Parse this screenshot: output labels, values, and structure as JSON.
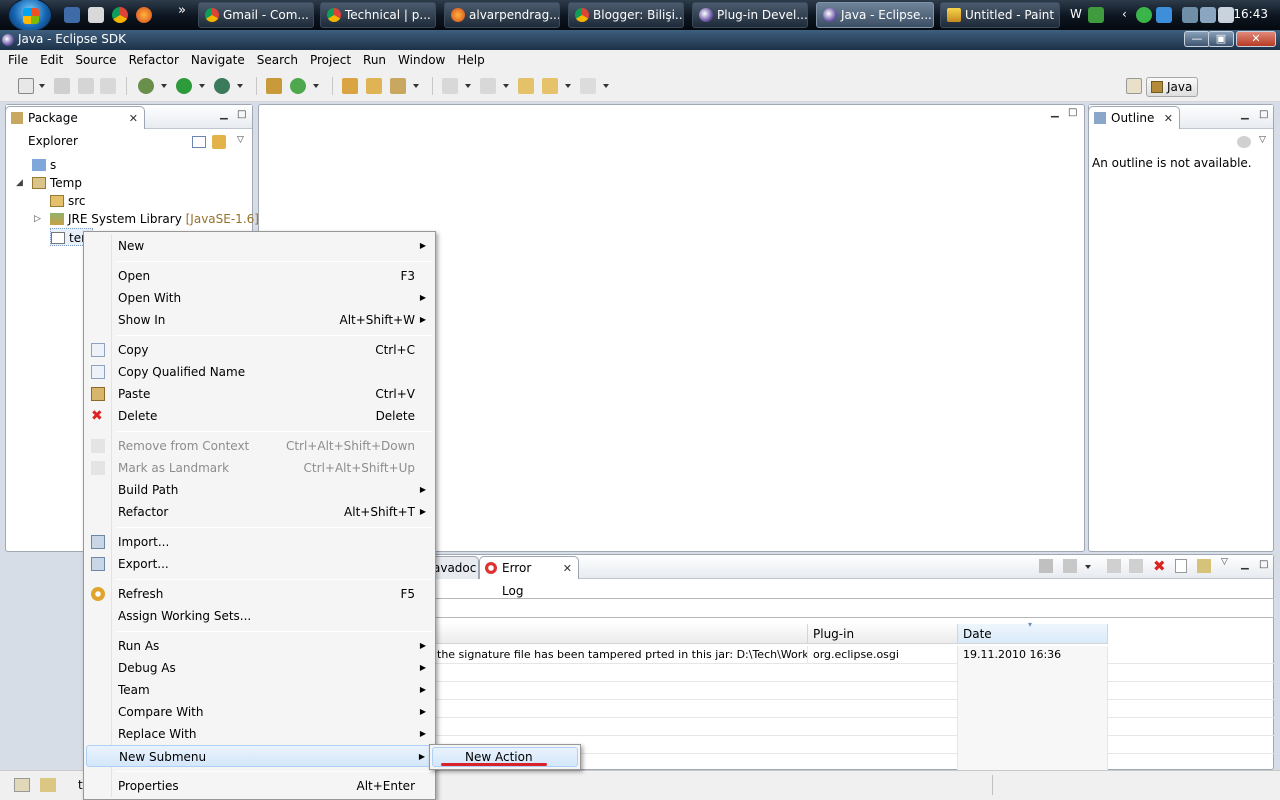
{
  "taskbar": {
    "buttons": [
      {
        "label": "Gmail - Com...",
        "icon": "chrome-icon"
      },
      {
        "label": "Technical | p...",
        "icon": "chrome-icon"
      },
      {
        "label": "alvarpendrag...",
        "icon": "firefox-icon"
      },
      {
        "label": "Blogger: Bilişi...",
        "icon": "chrome-icon"
      },
      {
        "label": "Plug-in Devel...",
        "icon": "eclipse-icon"
      },
      {
        "label": "Java - Eclipse...",
        "icon": "eclipse-icon",
        "active": true
      },
      {
        "label": "Untitled - Paint",
        "icon": "paint-icon"
      }
    ],
    "tray_letter": "W",
    "clock": "16:43"
  },
  "window": {
    "title": "Java - Eclipse SDK"
  },
  "menubar": [
    "File",
    "Edit",
    "Source",
    "Refactor",
    "Navigate",
    "Search",
    "Project",
    "Run",
    "Window",
    "Help"
  ],
  "perspective": {
    "label": "Java"
  },
  "package_explorer": {
    "tab": "Package Explorer",
    "tree": [
      {
        "label": "s",
        "depth": 0,
        "icon": "project-icon"
      },
      {
        "label": "Temp",
        "depth": 0,
        "icon": "project-open-icon",
        "expanded": true
      },
      {
        "label": "src",
        "depth": 1,
        "icon": "package-folder-icon"
      },
      {
        "label": "JRE System Library",
        "tag": "[JavaSE-1.6]",
        "depth": 1,
        "icon": "library-icon"
      },
      {
        "label": "ter",
        "depth": 1,
        "icon": "file-icon",
        "selected": true
      }
    ]
  },
  "outline": {
    "tab": "Outline",
    "message": "An outline is not available."
  },
  "bottom_panel": {
    "tabs": [
      "avadoc",
      "Error Log"
    ],
    "columns": [
      "Plug-in",
      "Date"
    ],
    "rows": [
      {
        "message": "the signature file has been tampered prted in this jar: D:\\Tech\\WorkSpaces\\H",
        "plugin": "org.eclipse.osgi",
        "date": "19.11.2010 16:36"
      }
    ]
  },
  "status": {
    "text": "t"
  },
  "context_menu": {
    "items": [
      {
        "label": "New",
        "submenu": true,
        "icon": ""
      },
      {
        "sep": true
      },
      {
        "label": "Open",
        "shortcut": "F3"
      },
      {
        "label": "Open With",
        "submenu": true
      },
      {
        "label": "Show In",
        "shortcut": "Alt+Shift+W",
        "submenu": true
      },
      {
        "sep": true
      },
      {
        "label": "Copy",
        "shortcut": "Ctrl+C",
        "icon": "copy-icon"
      },
      {
        "label": "Copy Qualified Name",
        "icon": "copy-qualified-icon"
      },
      {
        "label": "Paste",
        "shortcut": "Ctrl+V",
        "icon": "paste-icon"
      },
      {
        "label": "Delete",
        "shortcut": "Delete",
        "icon": "delete-icon"
      },
      {
        "sep": true
      },
      {
        "label": "Remove from Context",
        "shortcut": "Ctrl+Alt+Shift+Down",
        "disabled": true,
        "icon": "remove-context-icon"
      },
      {
        "label": "Mark as Landmark",
        "shortcut": "Ctrl+Alt+Shift+Up",
        "disabled": true,
        "icon": "landmark-icon"
      },
      {
        "label": "Build Path",
        "submenu": true
      },
      {
        "label": "Refactor",
        "shortcut": "Alt+Shift+T",
        "submenu": true
      },
      {
        "sep": true
      },
      {
        "label": "Import...",
        "icon": "import-icon"
      },
      {
        "label": "Export...",
        "icon": "export-icon"
      },
      {
        "sep": true
      },
      {
        "label": "Refresh",
        "shortcut": "F5",
        "icon": "refresh-icon"
      },
      {
        "label": "Assign Working Sets..."
      },
      {
        "sep": true
      },
      {
        "label": "Run As",
        "submenu": true
      },
      {
        "label": "Debug As",
        "submenu": true
      },
      {
        "label": "Team",
        "submenu": true
      },
      {
        "label": "Compare With",
        "submenu": true
      },
      {
        "label": "Replace With",
        "submenu": true
      },
      {
        "label": "New Submenu",
        "submenu": true,
        "highlighted": true
      },
      {
        "sep": true
      },
      {
        "label": "Properties",
        "shortcut": "Alt+Enter"
      }
    ],
    "submenu_item": "New Action"
  }
}
